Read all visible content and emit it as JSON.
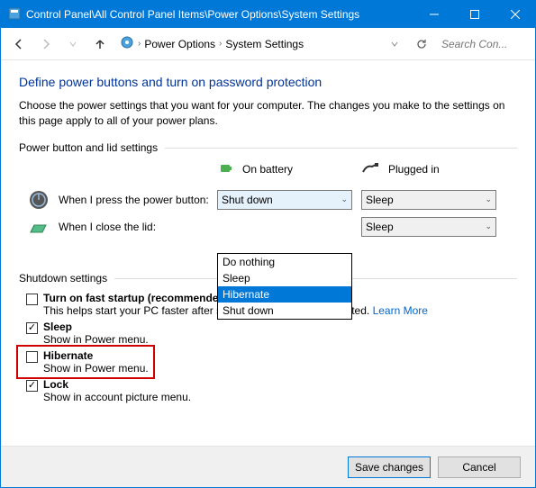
{
  "window": {
    "title": "Control Panel\\All Control Panel Items\\Power Options\\System Settings"
  },
  "breadcrumb": {
    "item1": "Power Options",
    "item2": "System Settings"
  },
  "search": {
    "placeholder": "Search Con..."
  },
  "heading": "Define power buttons and turn on password protection",
  "intro": "Choose the power settings that you want for your computer. The changes you make to the settings on this page apply to all of your power plans.",
  "section1": "Power button and lid settings",
  "headers": {
    "battery": "On battery",
    "plugged": "Plugged in"
  },
  "rows": {
    "power_button": {
      "label": "When I press the power button:",
      "battery": "Shut down",
      "plugged": "Sleep"
    },
    "lid": {
      "label": "When I close the lid:",
      "battery": "",
      "plugged": "Sleep"
    }
  },
  "dropdown_options": {
    "o0": "Do nothing",
    "o1": "Sleep",
    "o2": "Hibernate",
    "o3": "Shut down"
  },
  "section2": "Shutdown settings",
  "shutdown": {
    "fast": {
      "title": "Turn on fast startup (recommended)",
      "desc": "This helps start your PC faster after shutdown. Restart isn't affected. ",
      "link": "Learn More"
    },
    "sleep": {
      "title": "Sleep",
      "desc": "Show in Power menu."
    },
    "hibernate": {
      "title": "Hibernate",
      "desc": "Show in Power menu."
    },
    "lock": {
      "title": "Lock",
      "desc": "Show in account picture menu."
    }
  },
  "footer": {
    "save": "Save changes",
    "cancel": "Cancel"
  }
}
